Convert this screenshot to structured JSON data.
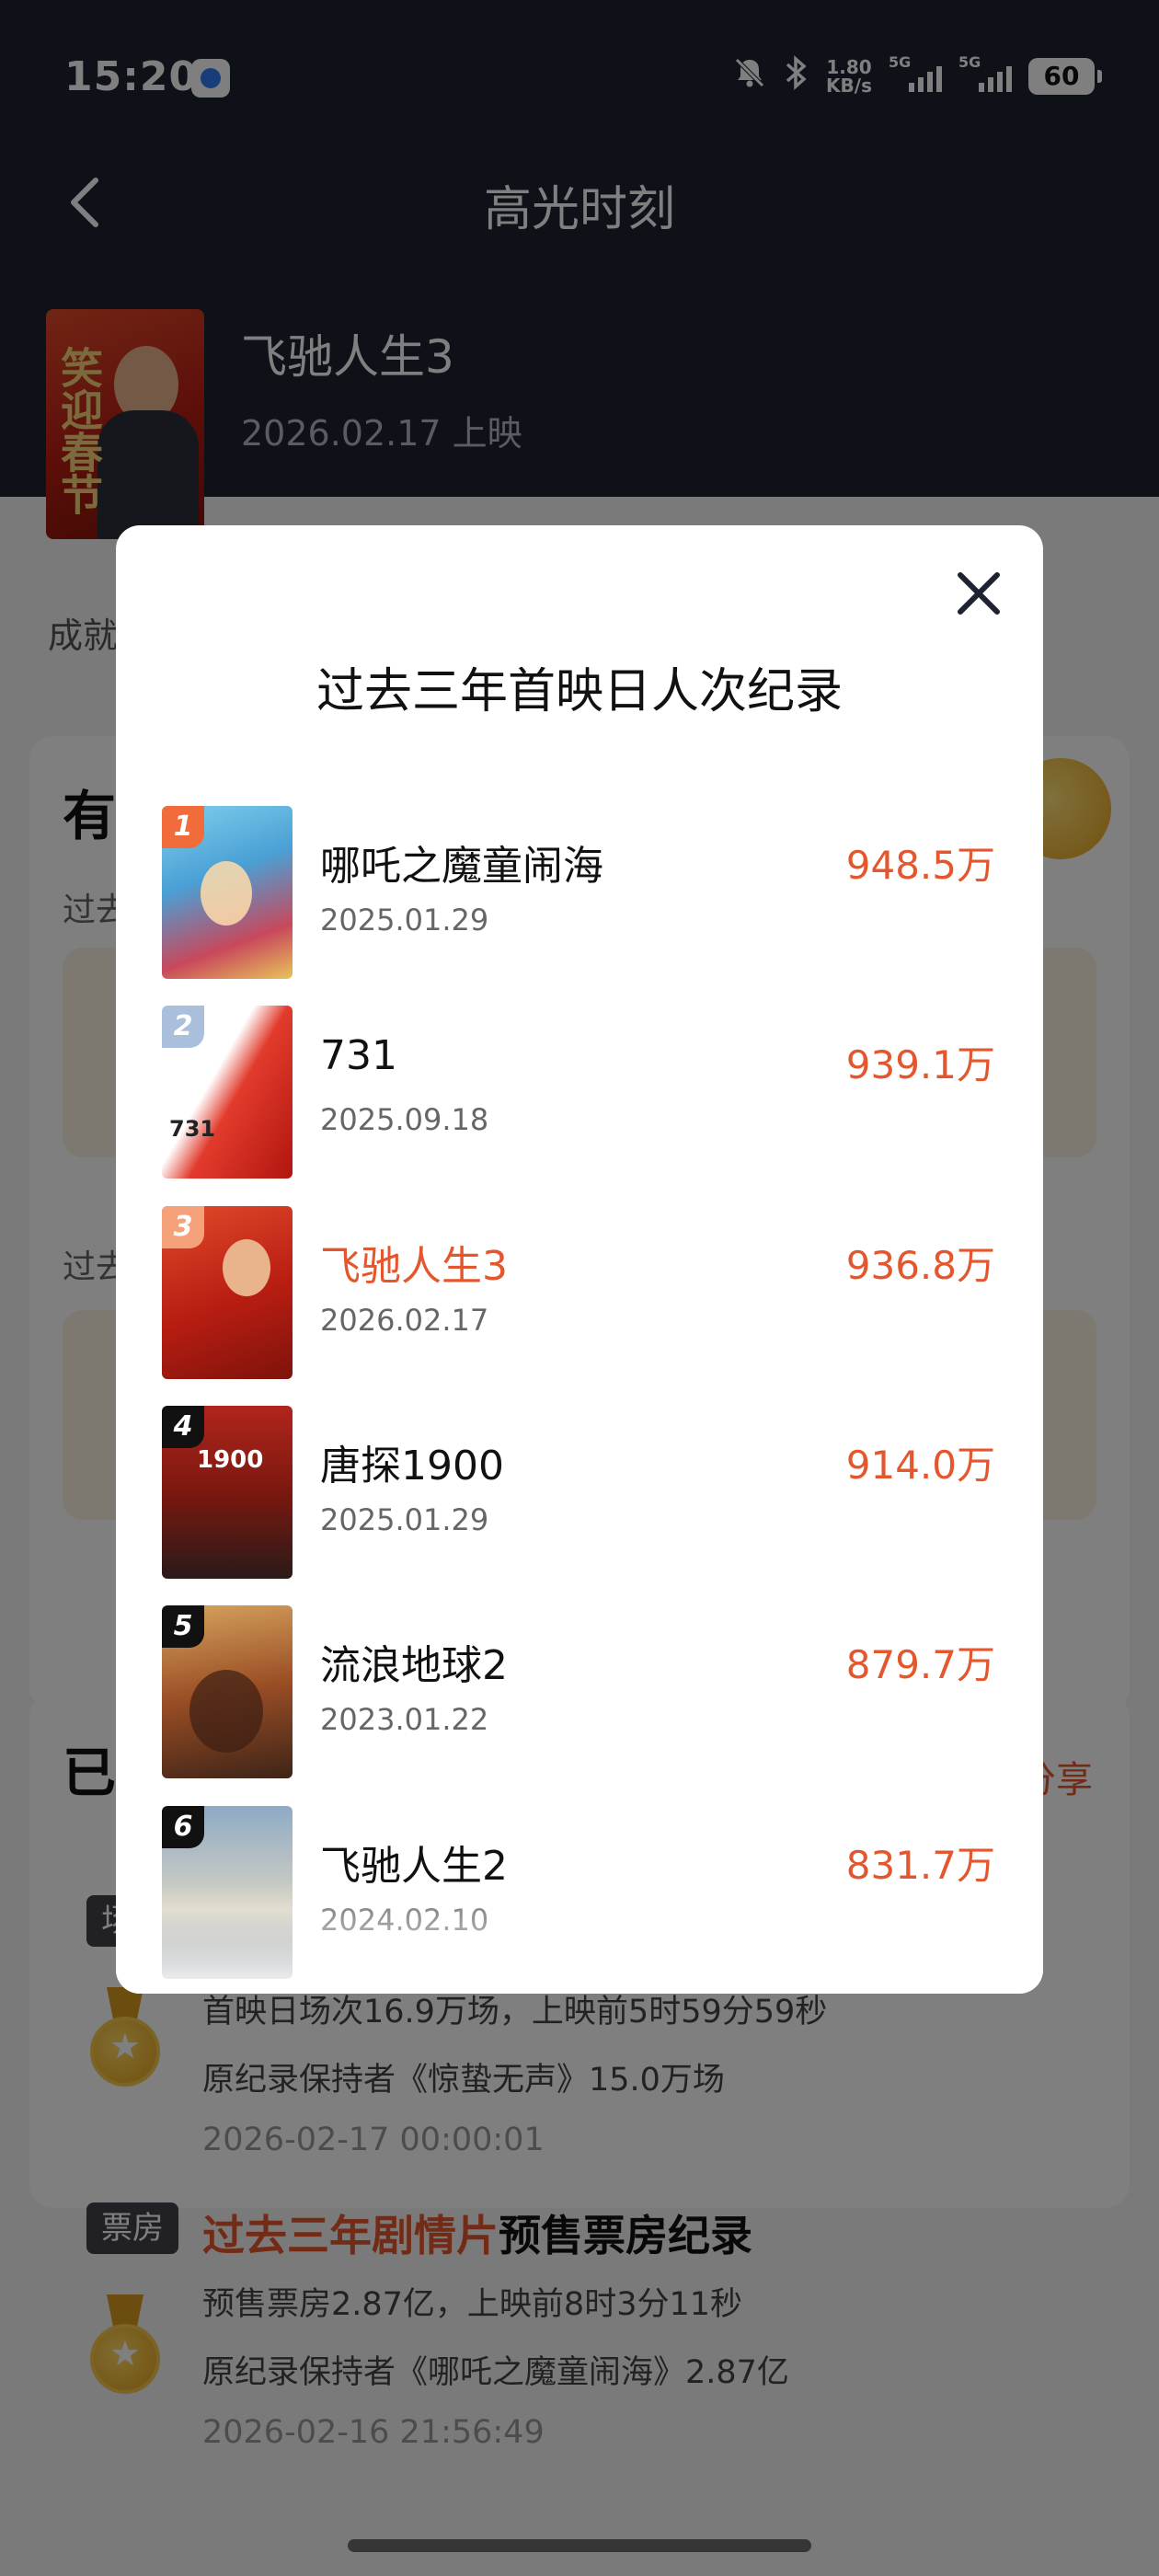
{
  "status_bar": {
    "time": "15:20",
    "speed_value": "1.80",
    "speed_unit": "KB/s",
    "signal1_label": "5G",
    "signal2_label": "5G",
    "battery": "60",
    "icons": [
      "app-icon",
      "mute-icon",
      "bluetooth-icon",
      "signal-icon",
      "battery-icon"
    ]
  },
  "header": {
    "title": "高光时刻",
    "back_icon": "chevron-left-icon"
  },
  "movie": {
    "name": "飞驰人生3",
    "release": "2026.02.17 上映",
    "poster_text": "笑迎春节"
  },
  "page": {
    "section_label": "成就",
    "card1_heading": "有",
    "card1_sub1": "过去",
    "card1_sub2": "过去",
    "card2_heading": "已",
    "share_label": "分享"
  },
  "records": [
    {
      "tag": "场",
      "title_highlight": "",
      "title_rest": "",
      "line1": "首映日场次16.9万场，上映前5时59分59秒",
      "line2": "原纪录保持者《惊蛰无声》15.0万场",
      "time": "2026-02-17 00:00:01"
    },
    {
      "tag": "票房",
      "title_highlight": "过去三年剧情片",
      "title_rest": "预售票房纪录",
      "line1": "预售票房2.87亿，上映前8时3分11秒",
      "line2": "原纪录保持者《哪吒之魔童闹海》2.87亿",
      "time": "2026-02-16 21:56:49"
    }
  ],
  "modal": {
    "title": "过去三年首映日人次纪录",
    "close_icon": "close-icon",
    "rank_colors": [
      "#f26b3a",
      "#a9bfdc",
      "#f5a27a",
      "#111111",
      "#111111",
      "#111111"
    ],
    "items": [
      {
        "rank": "1",
        "name": "哪吒之魔童闹海",
        "date": "2025.01.29",
        "value": "948.5万"
      },
      {
        "rank": "2",
        "name": "731",
        "date": "2025.09.18",
        "value": "939.1万"
      },
      {
        "rank": "3",
        "name": "飞驰人生3",
        "date": "2026.02.17",
        "value": "936.8万",
        "current": true
      },
      {
        "rank": "4",
        "name": "唐探1900",
        "date": "2025.01.29",
        "value": "914.0万"
      },
      {
        "rank": "5",
        "name": "流浪地球2",
        "date": "2023.01.22",
        "value": "879.7万"
      },
      {
        "rank": "6",
        "name": "飞驰人生2",
        "date": "2024.02.10",
        "value": "831.7万"
      }
    ]
  },
  "colors": {
    "accent": "#e4572e",
    "header_bg": "#1d2331",
    "overlay": "rgba(0,0,0,0.5)"
  }
}
